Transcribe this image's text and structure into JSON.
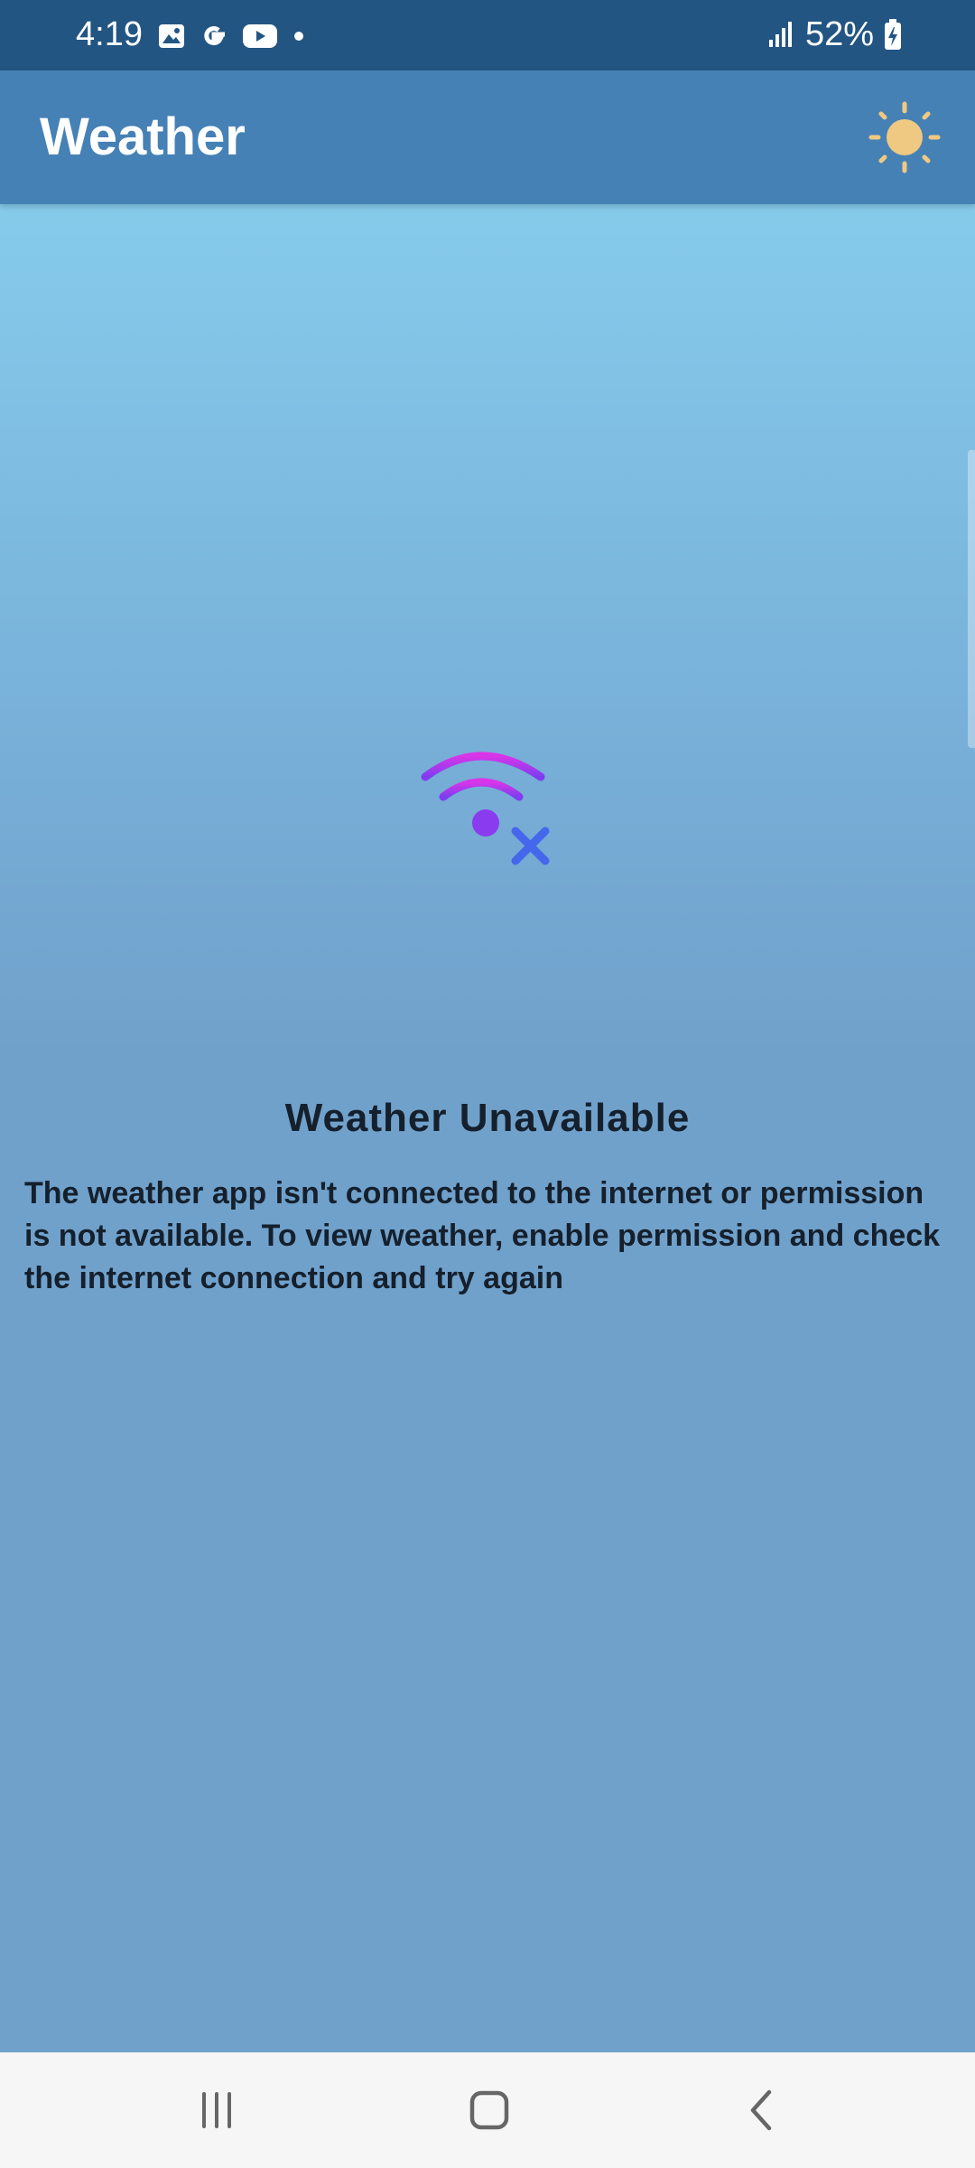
{
  "status_bar": {
    "time": "4:19",
    "notification_icons": [
      "gallery-icon",
      "google-icon",
      "youtube-icon",
      "dot-icon"
    ],
    "signal_icon": "signal-icon",
    "battery_percent": "52%",
    "battery_icon": "battery-charging-icon"
  },
  "app_bar": {
    "title": "Weather",
    "theme_icon": "sun-icon",
    "background_color": "#4681b5"
  },
  "main": {
    "status_icon": "no-wifi-icon",
    "error_title": "Weather Unavailable",
    "error_message": "The weather app isn't connected to the internet or permission is not available. To view weather, enable permission and check the internet connection and try again"
  },
  "nav_bar": {
    "buttons": [
      "recent-apps",
      "home",
      "back"
    ]
  },
  "colors": {
    "status_bar": "#235582",
    "accent_sun": "#efc982",
    "wifi_gradient_top": "#d935e8",
    "wifi_gradient_bottom": "#7e3df0",
    "x_mark": "#4467ec",
    "text_dark": "#15202c"
  }
}
